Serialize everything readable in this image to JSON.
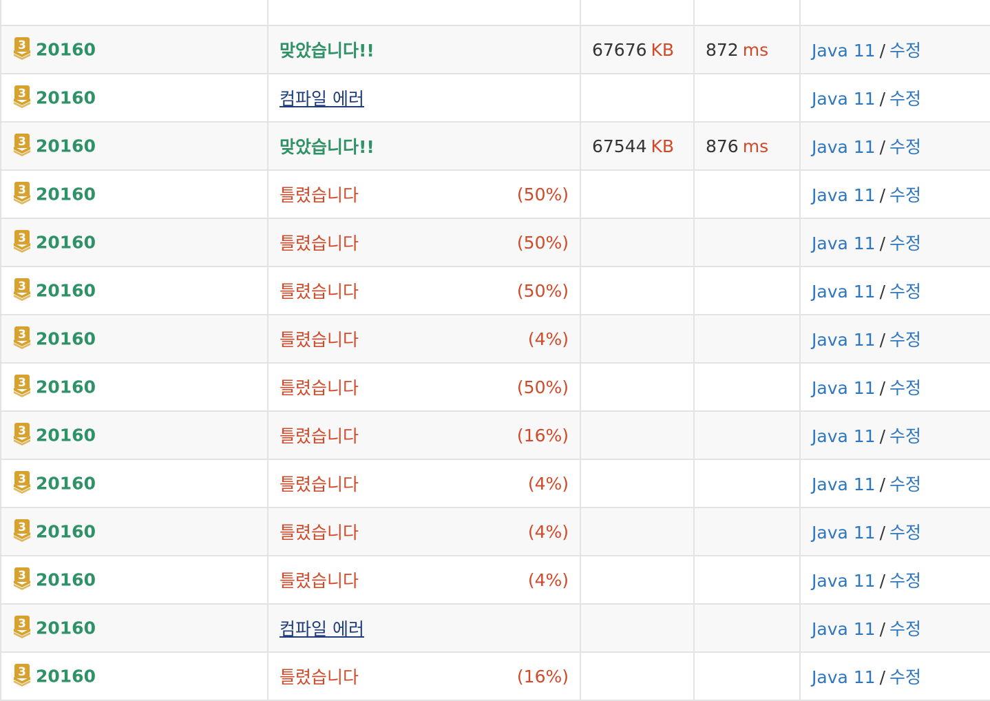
{
  "colors": {
    "accepted": "#2f9266",
    "wrong": "#d04a2a",
    "compile_error": "#1f3d7a",
    "link": "#2e76c0",
    "tier_bronze3": "#d8a02c"
  },
  "tier_icon": {
    "name": "bronze-tier-icon",
    "label": "3"
  },
  "rows": [
    {
      "problem": "20160",
      "result": "맞았습니다!!",
      "result_type": "ac",
      "percent": "",
      "memory": "67676",
      "memory_unit": "KB",
      "time": "872",
      "time_unit": "ms",
      "language": "Java 11",
      "slash": "/",
      "edit": "수정"
    },
    {
      "problem": "20160",
      "result": "컴파일 에러",
      "result_type": "ce",
      "percent": "",
      "memory": "",
      "memory_unit": "",
      "time": "",
      "time_unit": "",
      "language": "Java 11",
      "slash": "/",
      "edit": "수정"
    },
    {
      "problem": "20160",
      "result": "맞았습니다!!",
      "result_type": "ac",
      "percent": "",
      "memory": "67544",
      "memory_unit": "KB",
      "time": "876",
      "time_unit": "ms",
      "language": "Java 11",
      "slash": "/",
      "edit": "수정"
    },
    {
      "problem": "20160",
      "result": "틀렸습니다",
      "result_type": "wa",
      "percent": "(50%)",
      "memory": "",
      "memory_unit": "",
      "time": "",
      "time_unit": "",
      "language": "Java 11",
      "slash": "/",
      "edit": "수정"
    },
    {
      "problem": "20160",
      "result": "틀렸습니다",
      "result_type": "wa",
      "percent": "(50%)",
      "memory": "",
      "memory_unit": "",
      "time": "",
      "time_unit": "",
      "language": "Java 11",
      "slash": "/",
      "edit": "수정"
    },
    {
      "problem": "20160",
      "result": "틀렸습니다",
      "result_type": "wa",
      "percent": "(50%)",
      "memory": "",
      "memory_unit": "",
      "time": "",
      "time_unit": "",
      "language": "Java 11",
      "slash": "/",
      "edit": "수정"
    },
    {
      "problem": "20160",
      "result": "틀렸습니다",
      "result_type": "wa",
      "percent": "(4%)",
      "memory": "",
      "memory_unit": "",
      "time": "",
      "time_unit": "",
      "language": "Java 11",
      "slash": "/",
      "edit": "수정"
    },
    {
      "problem": "20160",
      "result": "틀렸습니다",
      "result_type": "wa",
      "percent": "(50%)",
      "memory": "",
      "memory_unit": "",
      "time": "",
      "time_unit": "",
      "language": "Java 11",
      "slash": "/",
      "edit": "수정"
    },
    {
      "problem": "20160",
      "result": "틀렸습니다",
      "result_type": "wa",
      "percent": "(16%)",
      "memory": "",
      "memory_unit": "",
      "time": "",
      "time_unit": "",
      "language": "Java 11",
      "slash": "/",
      "edit": "수정"
    },
    {
      "problem": "20160",
      "result": "틀렸습니다",
      "result_type": "wa",
      "percent": "(4%)",
      "memory": "",
      "memory_unit": "",
      "time": "",
      "time_unit": "",
      "language": "Java 11",
      "slash": "/",
      "edit": "수정"
    },
    {
      "problem": "20160",
      "result": "틀렸습니다",
      "result_type": "wa",
      "percent": "(4%)",
      "memory": "",
      "memory_unit": "",
      "time": "",
      "time_unit": "",
      "language": "Java 11",
      "slash": "/",
      "edit": "수정"
    },
    {
      "problem": "20160",
      "result": "틀렸습니다",
      "result_type": "wa",
      "percent": "(4%)",
      "memory": "",
      "memory_unit": "",
      "time": "",
      "time_unit": "",
      "language": "Java 11",
      "slash": "/",
      "edit": "수정"
    },
    {
      "problem": "20160",
      "result": "컴파일 에러",
      "result_type": "ce",
      "percent": "",
      "memory": "",
      "memory_unit": "",
      "time": "",
      "time_unit": "",
      "language": "Java 11",
      "slash": "/",
      "edit": "수정"
    },
    {
      "problem": "20160",
      "result": "틀렸습니다",
      "result_type": "wa",
      "percent": "(16%)",
      "memory": "",
      "memory_unit": "",
      "time": "",
      "time_unit": "",
      "language": "Java 11",
      "slash": "/",
      "edit": "수정"
    }
  ]
}
